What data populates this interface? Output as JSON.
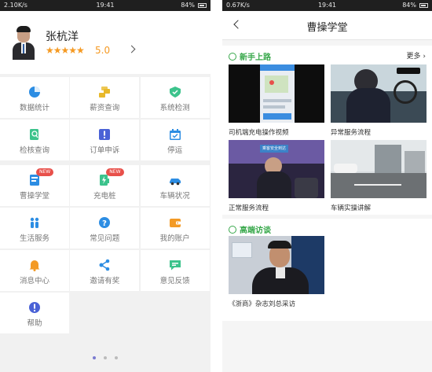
{
  "left": {
    "status": {
      "speed": "2.10K/s",
      "time": "19:41",
      "battery": "84%"
    },
    "profile": {
      "name": "张杭洋",
      "stars": "★★★★★",
      "rating": "5.0"
    },
    "menu": [
      {
        "label": "数据统计",
        "icon": "pie-chart-icon",
        "color": "#2c8de3"
      },
      {
        "label": "薪资查询",
        "icon": "coins-icon",
        "color": "#e8b92a"
      },
      {
        "label": "系统检测",
        "icon": "shield-icon",
        "color": "#3cc38c"
      },
      {
        "label": "检核查询",
        "icon": "doc-search-icon",
        "color": "#3cc38c"
      },
      {
        "label": "订单申诉",
        "icon": "alert-icon",
        "color": "#4a62d6"
      },
      {
        "label": "停运",
        "icon": "calendar-icon",
        "color": "#2c8de3"
      },
      {
        "label": "曹操学堂",
        "icon": "book-icon",
        "color": "#2c8de3",
        "badge": "NEW"
      },
      {
        "label": "充电桩",
        "icon": "charger-icon",
        "color": "#3cc38c",
        "badge": "NEW"
      },
      {
        "label": "车辆状况",
        "icon": "car-icon",
        "color": "#2c8de3"
      },
      {
        "label": "生活服务",
        "icon": "people-icon",
        "color": "#2c8de3"
      },
      {
        "label": "常见问题",
        "icon": "question-icon",
        "color": "#2c8de3"
      },
      {
        "label": "我的账户",
        "icon": "wallet-icon",
        "color": "#f39a25"
      },
      {
        "label": "消息中心",
        "icon": "bell-icon",
        "color": "#f39a25"
      },
      {
        "label": "邀请有奖",
        "icon": "share-icon",
        "color": "#2c8de3"
      },
      {
        "label": "意见反馈",
        "icon": "chat-icon",
        "color": "#3cc38c"
      },
      {
        "label": "帮助",
        "icon": "info-icon",
        "color": "#4a62d6"
      }
    ]
  },
  "right": {
    "status": {
      "speed": "0.67K/s",
      "time": "19:41",
      "battery": "84%"
    },
    "title": "曹操学堂",
    "newbie": {
      "heading": "新手上路",
      "more": "更多",
      "videos": [
        {
          "caption": "司机端充电操作视频"
        },
        {
          "caption": "异常服务流程"
        },
        {
          "caption": "正常服务流程"
        },
        {
          "caption": "车辆实操讲解"
        }
      ]
    },
    "interview": {
      "heading": "高端访谈",
      "videos": [
        {
          "caption": "《浙商》杂志刘总采访"
        }
      ]
    },
    "overlay": {
      "scene_label": "乘客安全到达"
    }
  }
}
